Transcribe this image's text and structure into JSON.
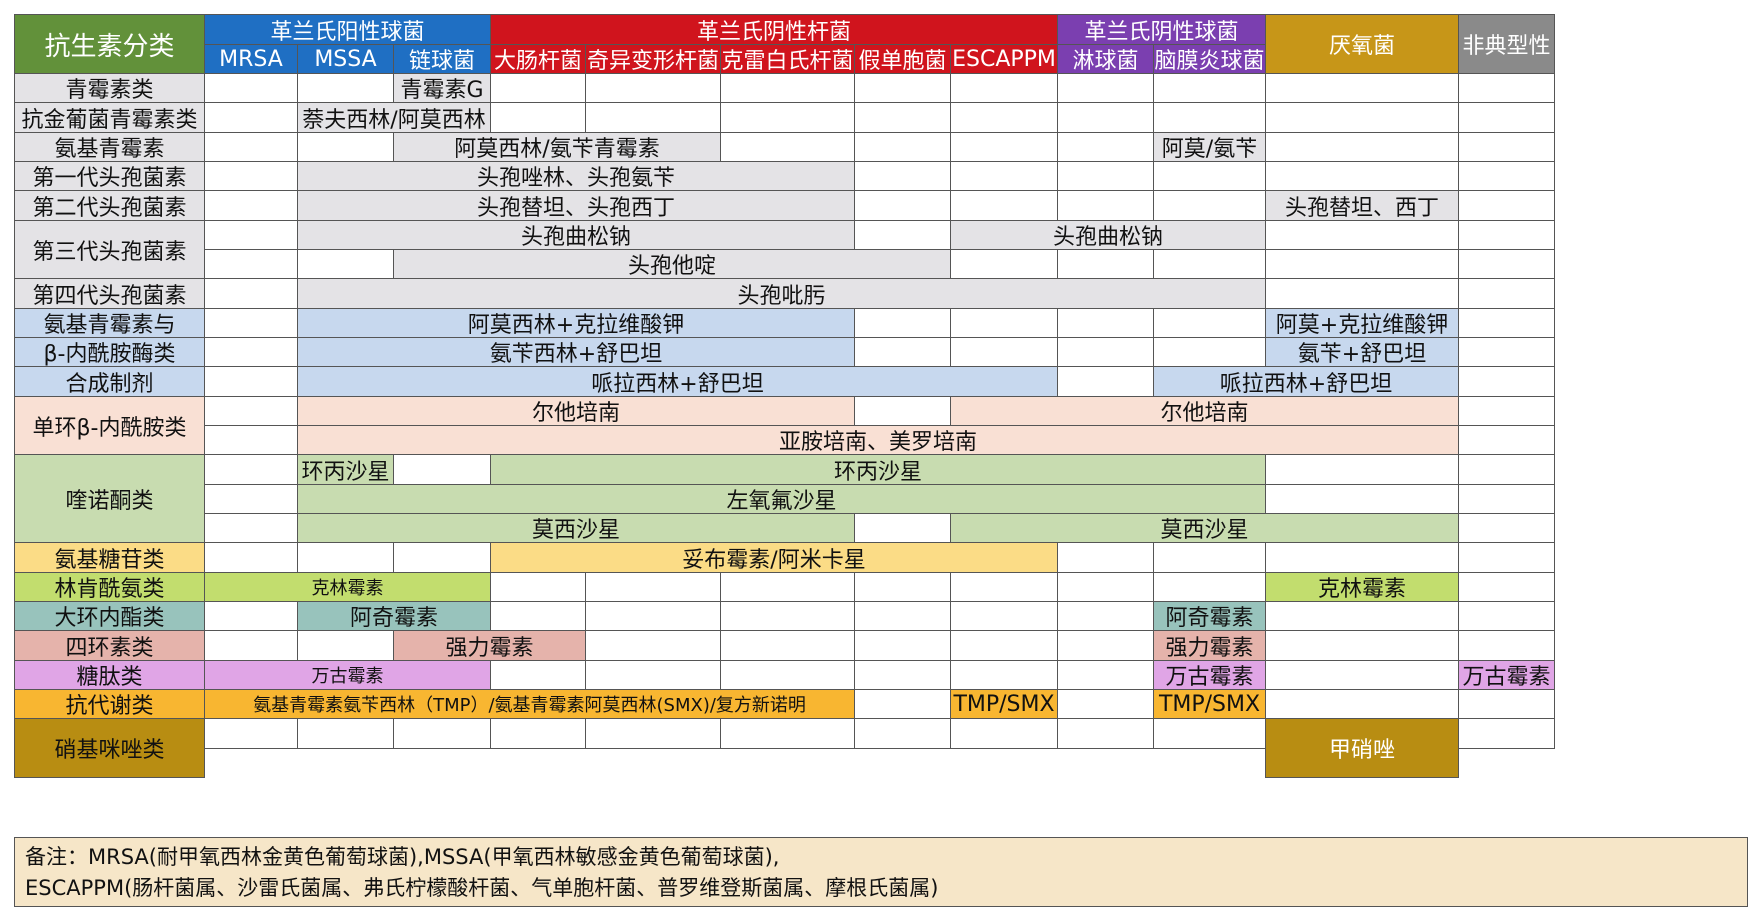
{
  "title": "抗生素分类",
  "colors": {
    "title_bg": "#62913a",
    "gram_pos_cocci": "#1f6fc3",
    "gram_neg_rods": "#d0141d",
    "gram_neg_cocci": "#7b3fb0",
    "anaerobes": "#c79618",
    "atypical": "#8a8a8a",
    "grey_band": "#e4e3e6",
    "blue_band": "#c7d8ee",
    "peach_band": "#f9e0d4",
    "green_band": "#c8dcb0",
    "yellow_band": "#fbdc86",
    "lime_band": "#c2dd6e",
    "teal_band": "#98c3bc",
    "pink_band": "#e5b3ab",
    "violet_band": "#e0a5e6",
    "orange_band": "#f8b631",
    "olive_band": "#b88d12",
    "beige_note": "#f6e6c8"
  },
  "groups": {
    "gram_pos_cocci": "革兰氏阳性球菌",
    "gram_neg_rods": "革兰氏阴性杆菌",
    "gram_neg_cocci": "革兰氏阴性球菌",
    "anaerobes": "厌氧菌",
    "atypical": "非典型性"
  },
  "organisms": {
    "mrsa": "MRSA",
    "mssa": "MSSA",
    "strep": "链球菌",
    "ecoli": "大肠杆菌",
    "proteus": "奇异变形杆菌",
    "klebsiella": "克雷白氏杆菌",
    "pseudomonas": "假单胞菌",
    "escappm": "ESCAPPM",
    "gonococcus": "淋球菌",
    "meningococcus": "脑膜炎球菌"
  },
  "classes": {
    "penicillin": "青霉素类",
    "anti_staph": "抗金葡菌青霉素类",
    "amino_pen": "氨基青霉素",
    "ceph1": "第一代头孢菌素",
    "ceph2": "第二代头孢菌素",
    "ceph3": "第三代头孢菌素",
    "ceph4": "第四代头孢菌素",
    "bli_1": "氨基青霉素与",
    "bli_2": "β-内酰胺酶类",
    "bli_3": "合成制剂",
    "monobactam": "单环β-内酰胺类",
    "quinolone": "喹诺酮类",
    "aminoglycoside": "氨基糖苷类",
    "lincosamide": "林肯酰氨类",
    "macrolide": "大环内酯类",
    "tetracycline": "四环素类",
    "glycopeptide": "糖肽类",
    "antimetabolite": "抗代谢类",
    "nitroimidazole": "硝基咪唑类"
  },
  "drugs": {
    "pen_g": "青霉素G",
    "nafcillin": "萘夫西林/阿莫西林",
    "amox_amp": "阿莫西林/氨苄青霉素",
    "amox_amp_short": "阿莫/氨苄",
    "cefazolin": "头孢唑林、头孢氨苄",
    "cefotetan": "头孢替坦、头孢西丁",
    "cefotetan_short": "头孢替坦、西丁",
    "ceftriaxone": "头孢曲松钠",
    "ceftriaxone_2": "头孢曲松钠",
    "ceftazidime": "头孢他啶",
    "cefepime": "头孢吡肟",
    "amox_clav": "阿莫西林+克拉维酸钾",
    "amox_clav_short": "阿莫+克拉维酸钾",
    "amp_sul": "氨苄西林+舒巴坦",
    "amp_sul_short": "氨苄+舒巴坦",
    "pip_taz": "哌拉西林+舒巴坦",
    "pip_taz_2": "哌拉西林+舒巴坦",
    "aztreonam": "尔他培南",
    "aztreonam_2": "尔他培南",
    "imipenem": "亚胺培南、美罗培南",
    "cipro_a": "环丙沙星",
    "cipro_b": "环丙沙星",
    "levo": "左氧氟沙星",
    "moxi_a": "莫西沙星",
    "moxi_b": "莫西沙星",
    "tobra": "妥布霉素/阿米卡星",
    "clinda": "克林霉素",
    "clinda_2": "克林霉素",
    "azithro": "阿奇霉素",
    "azithro_2": "阿奇霉素",
    "doxy": "强力霉素",
    "doxy_2": "强力霉素",
    "vanco": "万古霉素",
    "vanco_2": "万古霉素",
    "vanco_3": "万古霉素",
    "tmp_long": "氨基青霉素氨苄西林（TMP）/氨基青霉素阿莫西林(SMX)/复方新诺明",
    "tmp_smx": "TMP/SMX",
    "tmp_smx_2": "TMP/SMX",
    "metronidazole": "甲硝唑"
  },
  "note": {
    "line1": "备注：MRSA(耐甲氧西林金黄色葡萄球菌),MSSA(甲氧西林敏感金黄色葡萄球菌),",
    "line2": "ESCAPPM(肠杆菌属、沙雷氏菌属、弗氏柠檬酸杆菌、气单胞杆菌、普罗维登斯菌属、摩根氏菌属)"
  }
}
